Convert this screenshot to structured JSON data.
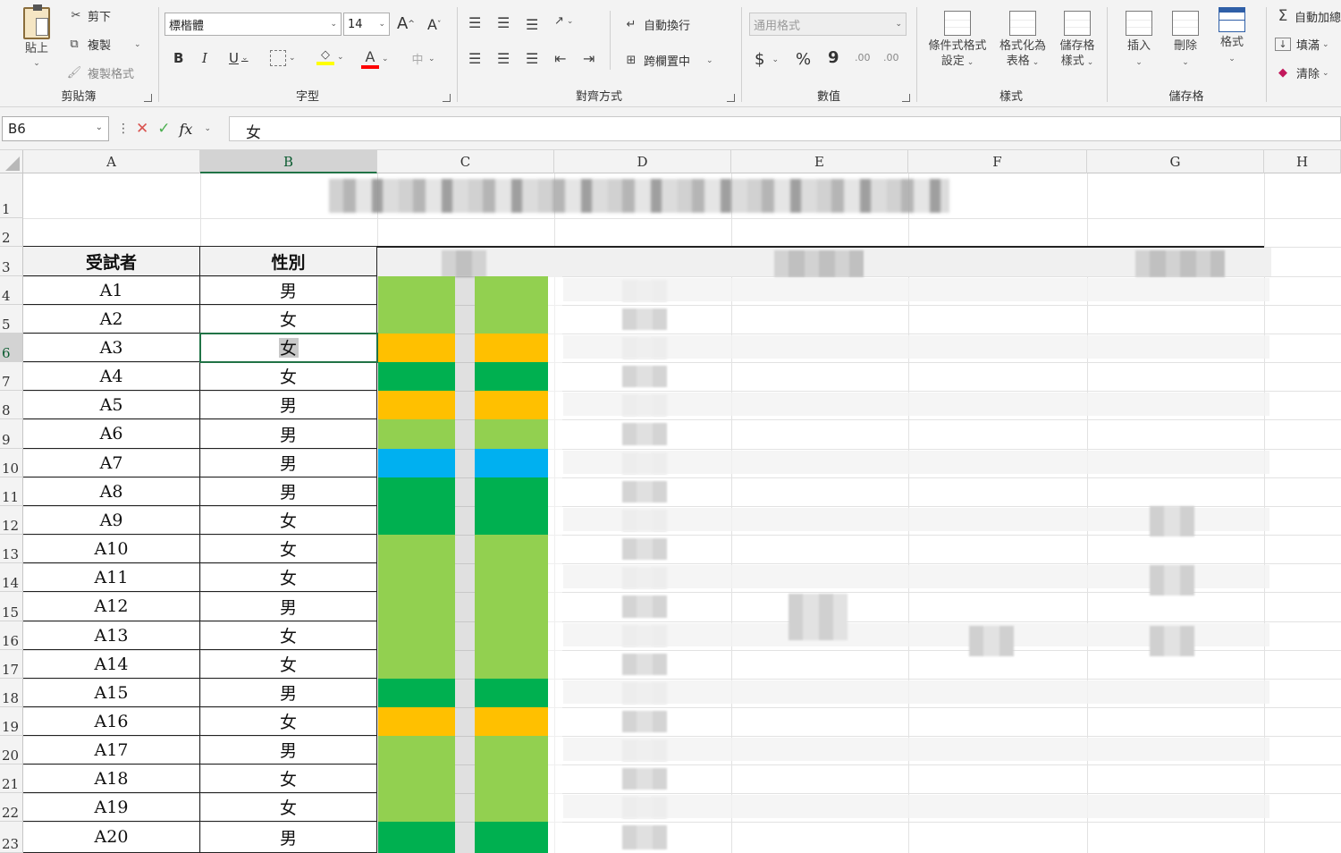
{
  "ribbon": {
    "clipboard": {
      "paste": "貼上",
      "cut": "剪下",
      "copy": "複製",
      "format_painter": "複製格式",
      "label": "剪貼簿"
    },
    "font": {
      "family": "標楷體",
      "size": "14",
      "bold": "B",
      "italic": "I",
      "underline": "U",
      "label": "字型",
      "grow": "A",
      "shrink": "A",
      "font_color_icon": "A"
    },
    "alignment": {
      "wrap": "自動換行",
      "merge": "跨欄置中",
      "label": "對齊方式"
    },
    "number": {
      "format": "通用格式",
      "currency": "$",
      "percent": "%",
      "comma": "9",
      "inc_decimal": ".00",
      "dec_decimal": ".00",
      "label": "數值"
    },
    "styles": {
      "conditional_l1": "條件式格式",
      "conditional_l2": "設定",
      "table_l1": "格式化為",
      "table_l2": "表格",
      "cell_styles_l1": "儲存格",
      "cell_styles_l2": "樣式",
      "label": "樣式"
    },
    "cells": {
      "insert": "插入",
      "delete": "刪除",
      "format": "格式",
      "label": "儲存格"
    },
    "editing": {
      "autosum": "自動加總",
      "fill": "填滿",
      "clear": "清除"
    }
  },
  "formula_bar": {
    "name_box": "B6",
    "content": "女",
    "fx": "fx"
  },
  "columns": [
    "A",
    "B",
    "C",
    "D",
    "E",
    "F",
    "G",
    "H"
  ],
  "rows": [
    "1",
    "2",
    "3",
    "4",
    "5",
    "6",
    "7",
    "8",
    "9",
    "10",
    "11",
    "12",
    "13",
    "14",
    "15",
    "16",
    "17",
    "18",
    "19",
    "20",
    "21",
    "22",
    "23"
  ],
  "table": {
    "headers": {
      "subject": "受試者",
      "gender": "性別"
    },
    "records": [
      {
        "id": "A1",
        "gender": "男"
      },
      {
        "id": "A2",
        "gender": "女"
      },
      {
        "id": "A3",
        "gender": "女"
      },
      {
        "id": "A4",
        "gender": "女"
      },
      {
        "id": "A5",
        "gender": "男"
      },
      {
        "id": "A6",
        "gender": "男"
      },
      {
        "id": "A7",
        "gender": "男"
      },
      {
        "id": "A8",
        "gender": "男"
      },
      {
        "id": "A9",
        "gender": "女"
      },
      {
        "id": "A10",
        "gender": "女"
      },
      {
        "id": "A11",
        "gender": "女"
      },
      {
        "id": "A12",
        "gender": "男"
      },
      {
        "id": "A13",
        "gender": "女"
      },
      {
        "id": "A14",
        "gender": "女"
      },
      {
        "id": "A15",
        "gender": "男"
      },
      {
        "id": "A16",
        "gender": "女"
      },
      {
        "id": "A17",
        "gender": "男"
      },
      {
        "id": "A18",
        "gender": "女"
      },
      {
        "id": "A19",
        "gender": "女"
      },
      {
        "id": "A20",
        "gender": "男"
      }
    ]
  },
  "colors": {
    "accent": "#217346",
    "lightgreen": "#92d050",
    "darkgreen": "#00b050",
    "olive": "#a9b62a",
    "orange": "#ffc000",
    "blue": "#00b0f0"
  },
  "col_c_fills": [
    "lightgreen",
    "lightgreen",
    "orange",
    "darkgreen",
    "orange",
    "lightgreen",
    "blue",
    "darkgreen",
    "darkgreen",
    "lightgreen",
    "lightgreen",
    "lightgreen",
    "lightgreen",
    "lightgreen",
    "darkgreen",
    "orange",
    "lightgreen",
    "lightgreen",
    "lightgreen",
    "darkgreen"
  ]
}
